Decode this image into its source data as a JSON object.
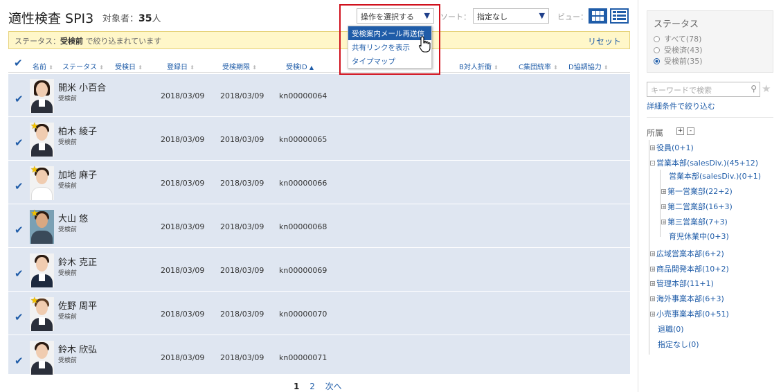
{
  "header": {
    "title": "適性検査 SPI3",
    "target_label": "対象者：",
    "target_count": "35",
    "target_unit": "人",
    "ops_select": "操作を選択する",
    "sort_label": "ソート：",
    "sort_value": "指定なし",
    "view_label": "ビュー："
  },
  "filter": {
    "prefix": "ステータス：",
    "value": "受検前",
    "suffix": " で絞り込まれています",
    "reset": "リセット"
  },
  "columns": {
    "name": "名前",
    "status": "ステータス",
    "exam_date": "受検日",
    "reg_date": "登録日",
    "deadline": "受検期限",
    "exam_id": "受検ID",
    "b": "B対人折衝",
    "c": "C集団統率",
    "d": "D協調協力"
  },
  "menu": {
    "items": [
      "受検案内メール再送信",
      "共有リンクを表示",
      "タイプマップ"
    ]
  },
  "rows": [
    {
      "name": "開米 小百合",
      "status": "受検前",
      "reg": "2018/03/09",
      "deadline": "2018/03/09",
      "id": "kn00000064"
    },
    {
      "name": "柏木 綾子",
      "status": "受検前",
      "reg": "2018/03/09",
      "deadline": "2018/03/09",
      "id": "kn00000065"
    },
    {
      "name": "加地 麻子",
      "status": "受検前",
      "reg": "2018/03/09",
      "deadline": "2018/03/09",
      "id": "kn00000066"
    },
    {
      "name": "大山 悠",
      "status": "受検前",
      "reg": "2018/03/09",
      "deadline": "2018/03/09",
      "id": "kn00000068"
    },
    {
      "name": "鈴木 克正",
      "status": "受検前",
      "reg": "2018/03/09",
      "deadline": "2018/03/09",
      "id": "kn00000069"
    },
    {
      "name": "佐野 周平",
      "status": "受検前",
      "reg": "2018/03/09",
      "deadline": "2018/03/09",
      "id": "kn00000070"
    },
    {
      "name": "鈴木 欣弘",
      "status": "受検前",
      "reg": "2018/03/09",
      "deadline": "2018/03/09",
      "id": "kn00000071"
    }
  ],
  "pager": {
    "current": "1",
    "next_page": "2",
    "next": "次へ"
  },
  "side": {
    "status_title": "ステータス",
    "status_options": [
      "すべて(78)",
      "受検済(43)",
      "受検前(35)"
    ],
    "search_placeholder": "キーワードで検索",
    "detail_link": "詳細条件で絞り込む",
    "org_title": "所属",
    "tree": [
      "役員(0+1)",
      "営業本部(salesDiv.)(45+12)",
      "営業本部(salesDiv.)(0+1)",
      "第一営業部(22+2)",
      "第二営業部(16+3)",
      "第三営業部(7+3)",
      "育児休業中(0+3)",
      "広域営業本部(6+2)",
      "商品開発本部(10+2)",
      "管理本部(11+1)",
      "海外事業本部(6+3)",
      "小売事業本部(0+51)",
      "退職(0)",
      "指定なし(0)"
    ]
  },
  "colors": {
    "accent": "#1f5ca8",
    "row_bg": "#dfe6f1",
    "highlight": "#d0101c",
    "filter_bg": "#fff7c9"
  }
}
